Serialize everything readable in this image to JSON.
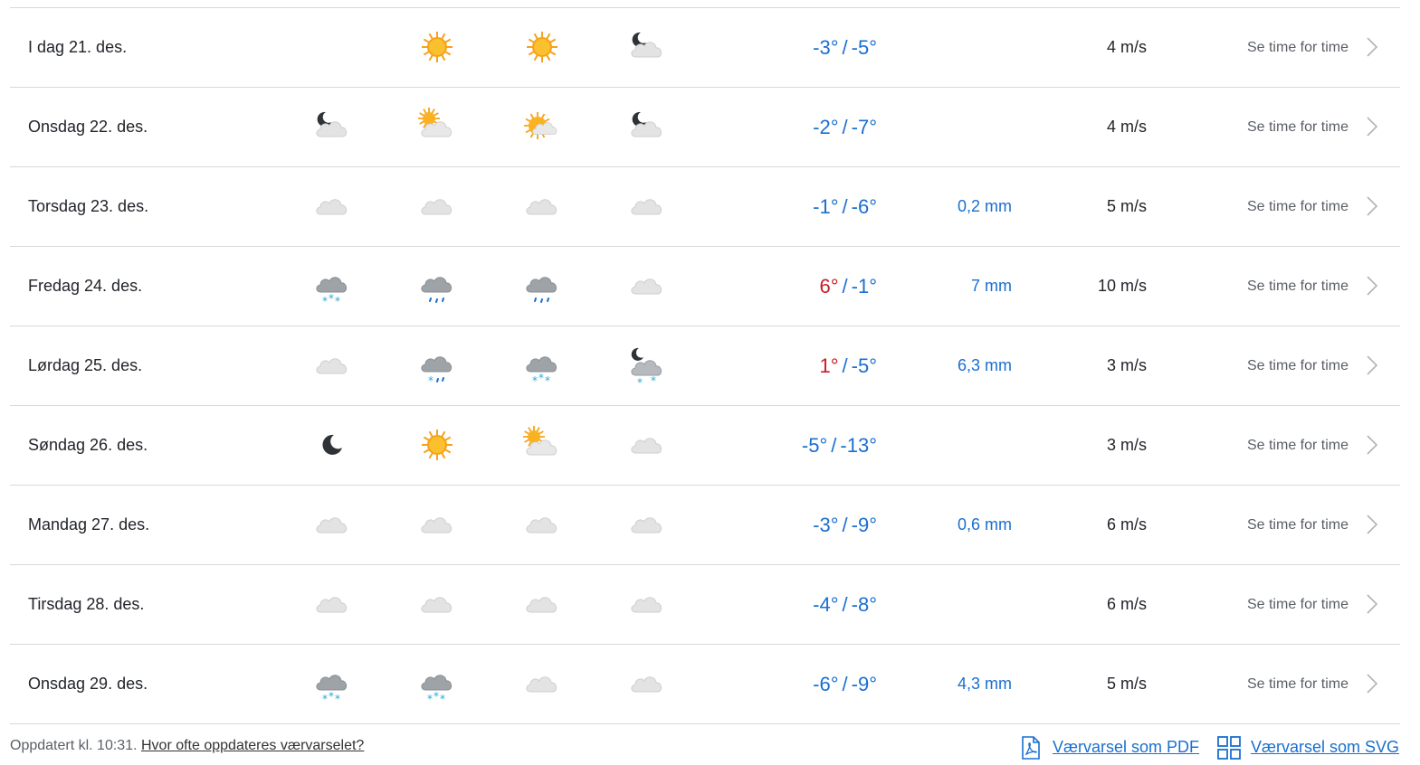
{
  "colors": {
    "cold": "#1a6fd0",
    "warm": "#c81d25",
    "border": "#d8d8d8"
  },
  "days": [
    {
      "date": "I dag 21. des.",
      "icons": [
        "",
        "sun",
        "sun",
        "moon-cloud"
      ],
      "tmax": "-3°",
      "tmax_warm": false,
      "tmin": "-5°",
      "precip": "",
      "wind": "4 m/s",
      "hourly": "Se time for time"
    },
    {
      "date": "Onsdag 22. des.",
      "icons": [
        "moon-cloud",
        "sun-cloud",
        "sun-cloud-small",
        "moon-cloud"
      ],
      "tmax": "-2°",
      "tmax_warm": false,
      "tmin": "-7°",
      "precip": "",
      "wind": "4 m/s",
      "hourly": "Se time for time"
    },
    {
      "date": "Torsdag 23. des.",
      "icons": [
        "cloud",
        "cloud",
        "cloud",
        "cloud"
      ],
      "tmax": "-1°",
      "tmax_warm": false,
      "tmin": "-6°",
      "precip": "0,2 mm",
      "wind": "5 m/s",
      "hourly": "Se time for time"
    },
    {
      "date": "Fredag 24. des.",
      "icons": [
        "snow-cloud",
        "rain-cloud",
        "rain-cloud",
        "cloud"
      ],
      "tmax": "6°",
      "tmax_warm": true,
      "tmin": "-1°",
      "precip": "7 mm",
      "wind": "10 m/s",
      "hourly": "Se time for time"
    },
    {
      "date": "Lørdag 25. des.",
      "icons": [
        "cloud",
        "sleet-cloud",
        "snow-cloud",
        "moon-snow-cloud"
      ],
      "tmax": "1°",
      "tmax_warm": true,
      "tmin": "-5°",
      "precip": "6,3 mm",
      "wind": "3 m/s",
      "hourly": "Se time for time"
    },
    {
      "date": "Søndag 26. des.",
      "icons": [
        "moon",
        "sun",
        "sun-cloud",
        "cloud"
      ],
      "tmax": "-5°",
      "tmax_warm": false,
      "tmin": "-13°",
      "precip": "",
      "wind": "3 m/s",
      "hourly": "Se time for time"
    },
    {
      "date": "Mandag 27. des.",
      "icons": [
        "cloud",
        "cloud",
        "cloud",
        "cloud"
      ],
      "tmax": "-3°",
      "tmax_warm": false,
      "tmin": "-9°",
      "precip": "0,6 mm",
      "wind": "6 m/s",
      "hourly": "Se time for time"
    },
    {
      "date": "Tirsdag 28. des.",
      "icons": [
        "cloud",
        "cloud",
        "cloud",
        "cloud"
      ],
      "tmax": "-4°",
      "tmax_warm": false,
      "tmin": "-8°",
      "precip": "",
      "wind": "6 m/s",
      "hourly": "Se time for time"
    },
    {
      "date": "Onsdag 29. des.",
      "icons": [
        "snow-cloud",
        "snow-cloud",
        "cloud",
        "cloud"
      ],
      "tmax": "-6°",
      "tmax_warm": false,
      "tmin": "-9°",
      "precip": "4,3 mm",
      "wind": "5 m/s",
      "hourly": "Se time for time"
    }
  ],
  "footer": {
    "updated": "Oppdatert kl. 10:31.",
    "faq_link": "Hvor ofte oppdateres værvarselet?",
    "pdf_link": "Værvarsel som PDF",
    "svg_link": "Værvarsel som SVG"
  }
}
